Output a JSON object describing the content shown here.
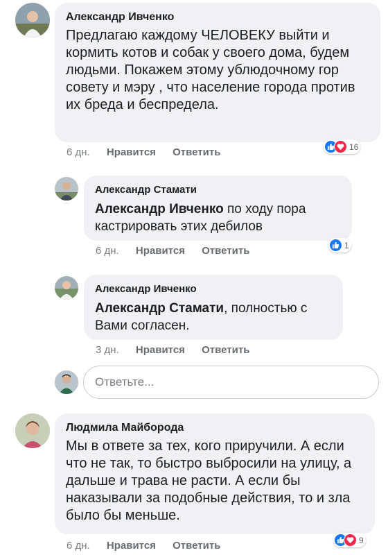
{
  "comments": [
    {
      "author": "Александр Ивченко",
      "text": "Предлагаю каждому ЧЕЛОВЕКУ выйти и кормить котов и собак у своего дома, будем людьми. Покажем этому ублюдочному гор совету и мэру , что население города против их бреда и беспредела.",
      "time": "6 дн.",
      "like_label": "Нравится",
      "reply_label": "Ответить",
      "reactions": [
        "like",
        "love"
      ],
      "reaction_count": "16"
    },
    {
      "author": "Александр Стамати",
      "mention": "Александр Ивченко",
      "text": " по ходу пора кастрировать этих дебилов",
      "time": "6 дн.",
      "like_label": "Нравится",
      "reply_label": "Ответить",
      "reactions": [
        "like"
      ],
      "reaction_count": "1"
    },
    {
      "author": "Александр Ивченко",
      "mention": "Александр Стамати",
      "text": ", полностью с Вами согласен.",
      "time": "3 дн.",
      "like_label": "Нравится",
      "reply_label": "Ответить"
    },
    {
      "author": "Людмила Майборода",
      "text": "Мы в ответе за тех, кого приручили. А если что не так, то быстро выбросили на улицу, а дальше и трава не расти. А если бы наказывали за подобные действия, то и зла было бы меньше.",
      "time": "6 дн.",
      "like_label": "Нравится",
      "reply_label": "Ответить",
      "reactions": [
        "like",
        "love"
      ],
      "reaction_count": "9"
    }
  ],
  "reply_input": {
    "placeholder": "Ответьте..."
  },
  "colors": {
    "like": "#1877f2",
    "love": "#f0284a",
    "bubble": "#eff1f4",
    "meta": "#7a7e85"
  }
}
